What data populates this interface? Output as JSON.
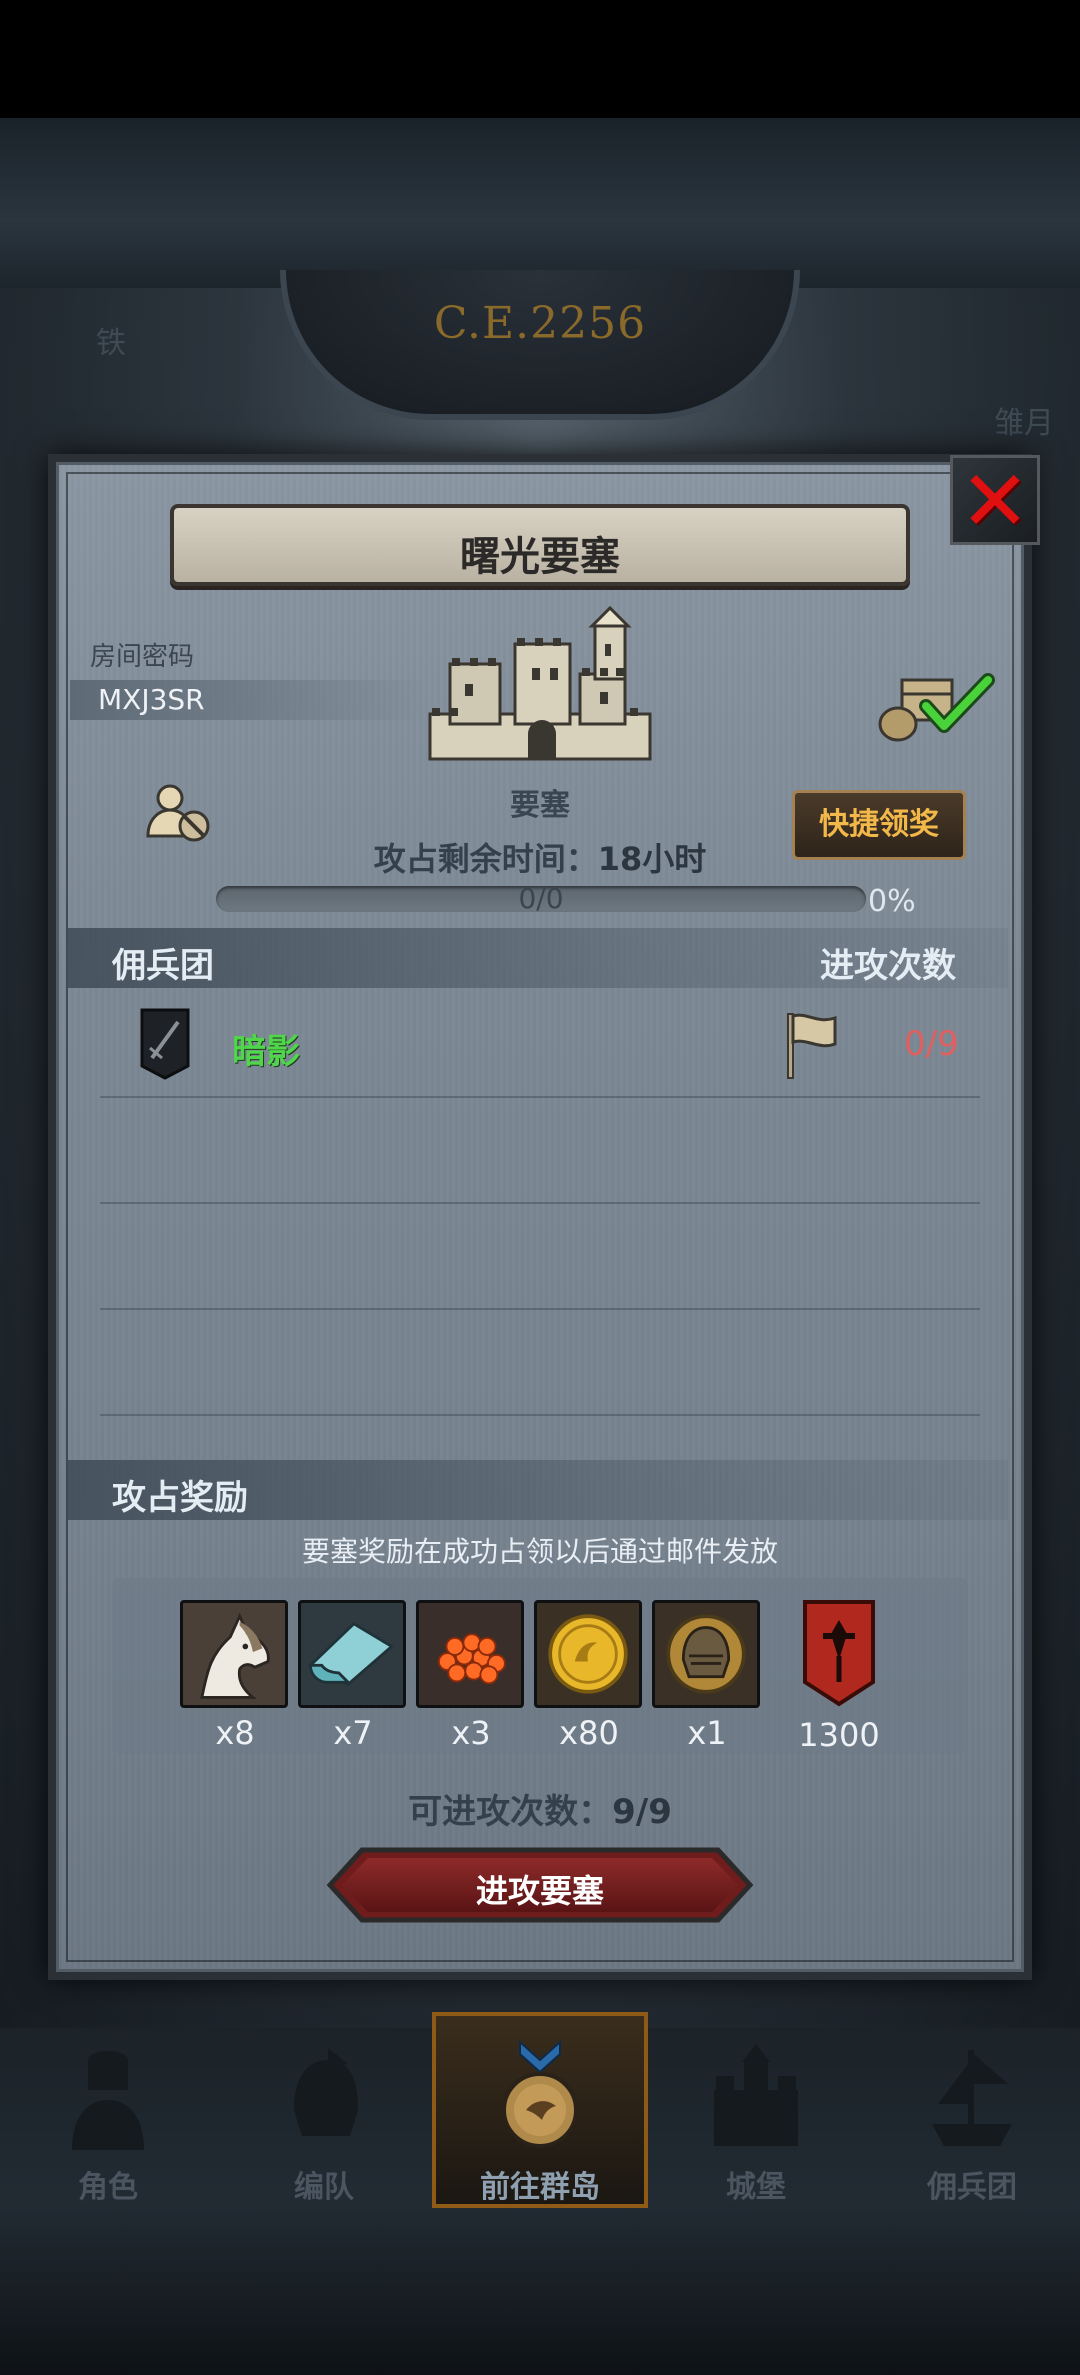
{
  "header": {
    "era": "C.E.2256",
    "left_label": "铁",
    "right_label": "雏月"
  },
  "dialog": {
    "title": "曙光要塞",
    "room": {
      "label": "房间密码",
      "code": "MXJ3SR"
    },
    "fortress_label": "要塞",
    "quick_claim_label": "快捷领奖",
    "remaining_time_label": "攻占剩余时间：",
    "remaining_time_value": "18小时",
    "progress": {
      "count": "0/0",
      "percent_text": "0%",
      "percent": 0
    },
    "guild_section": {
      "title": "佣兵团",
      "attacks_title": "进攻次数",
      "rows": [
        {
          "name": "暗影",
          "attacks": "0/9"
        }
      ]
    },
    "rewards_section": {
      "title": "攻占奖励",
      "note": "要塞奖励在成功占领以后通过邮件发放",
      "items": [
        {
          "icon": "horse-icon",
          "qty": "x8"
        },
        {
          "icon": "cloth-scroll-icon",
          "qty": "x7"
        },
        {
          "icon": "caviar-icon",
          "qty": "x3"
        },
        {
          "icon": "gold-coin-icon",
          "qty": "x80"
        },
        {
          "icon": "knight-helmet-icon",
          "qty": "x1"
        },
        {
          "icon": "guild-banner-icon",
          "qty": "1300"
        }
      ]
    },
    "attacks_available_label": "可进攻次数：",
    "attacks_available_value": "9/9",
    "attack_button_label": "进攻要塞"
  },
  "nav": {
    "items": [
      {
        "label": "角色",
        "icon": "knight-bust-icon"
      },
      {
        "label": "编队",
        "icon": "helmet-formation-icon"
      },
      {
        "label": "前往群岛",
        "icon": "island-compass-icon",
        "active": true
      },
      {
        "label": "城堡",
        "icon": "castle-icon"
      },
      {
        "label": "佣兵团",
        "icon": "ship-guild-icon"
      }
    ]
  },
  "colors": {
    "accent_gold": "#f3b84a",
    "guild_green": "#4fd64a",
    "attack_count_red": "#e06060",
    "close_red": "#e01010"
  }
}
